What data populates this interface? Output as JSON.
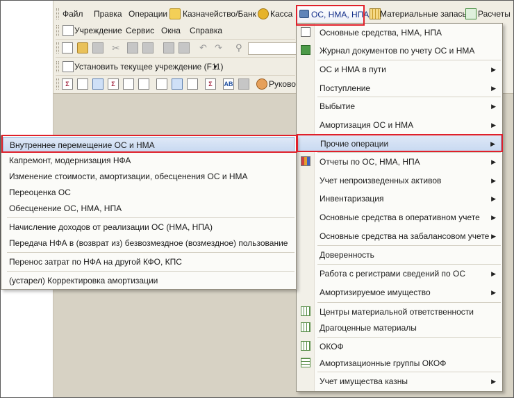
{
  "main_menu": {
    "file": "Файл",
    "edit": "Правка",
    "operations": "Операции",
    "treasury": "Казначейство/Банк",
    "cash": "Касса",
    "fixed_assets": "ОС, НМА, НПА",
    "materials": "Материальные запасы",
    "settlements": "Расчеты"
  },
  "second_menu": {
    "institution": "Учреждение",
    "service": "Сервис",
    "windows": "Окна",
    "help": "Справка"
  },
  "institution_toolbar": {
    "set_institution": "Установить текущее учреждение (F11)"
  },
  "report_toolbar": {
    "manager": "Руково"
  },
  "dropdown": {
    "items": [
      {
        "label": "Основные средства, НМА, НПА",
        "icon": "list-icon",
        "submenu": false
      },
      {
        "label": "Журнал документов по учету ОС и НМА",
        "icon": "journal-icon",
        "submenu": false
      },
      {
        "label": "ОС и НМА в пути",
        "icon": "",
        "submenu": true
      },
      {
        "label": "Поступление",
        "icon": "",
        "submenu": true
      },
      {
        "label": "Выбытие",
        "icon": "",
        "submenu": true
      },
      {
        "label": "Амортизация ОС и НМА",
        "icon": "",
        "submenu": true
      },
      {
        "label": "Прочие операции",
        "icon": "",
        "submenu": true
      },
      {
        "label": "Отчеты по ОС, НМА, НПА",
        "icon": "report-icon",
        "submenu": true
      },
      {
        "label": "Учет непроизведенных активов",
        "icon": "",
        "submenu": true
      },
      {
        "label": "Инвентаризация",
        "icon": "",
        "submenu": true
      },
      {
        "label": "Основные средства в оперативном учете",
        "icon": "",
        "submenu": true
      },
      {
        "label": "Основные средства на забалансовом учете",
        "icon": "",
        "submenu": true
      },
      {
        "label": "Доверенность",
        "icon": "",
        "submenu": false
      },
      {
        "label": "Работа с регистрами сведений по ОС",
        "icon": "",
        "submenu": true
      },
      {
        "label": "Амортизируемое имущество",
        "icon": "",
        "submenu": true
      },
      {
        "label": "Центры материальной ответственности",
        "icon": "table-icon",
        "submenu": false
      },
      {
        "label": "Драгоценные материалы",
        "icon": "table-icon",
        "submenu": false
      },
      {
        "label": "ОКОФ",
        "icon": "table-icon",
        "submenu": false
      },
      {
        "label": "Амортизационные группы ОКОФ",
        "icon": "grid-icon",
        "submenu": false
      },
      {
        "label": "Учет имущества казны",
        "icon": "",
        "submenu": true
      }
    ]
  },
  "submenu": {
    "items": [
      "Внутреннее перемещение ОС и НМА",
      "Капремонт, модернизация НФА",
      "Изменение стоимости, амортизации, обесценения ОС и НМА",
      "Переоценка ОС",
      "Обесценение ОС, НМА, НПА",
      "Начисление доходов от реализации ОС (НМА, НПА)",
      "Передача НФА в (возврат из) безвозмездное (возмездное) пользование",
      "Перенос затрат по НФА на другой КФО, КПС",
      "(устарел) Корректировка амортизации"
    ]
  },
  "colors": {
    "highlight_border": "#e0202a",
    "selection": "#c8d9f1",
    "workspace": "#d7d2c4"
  }
}
